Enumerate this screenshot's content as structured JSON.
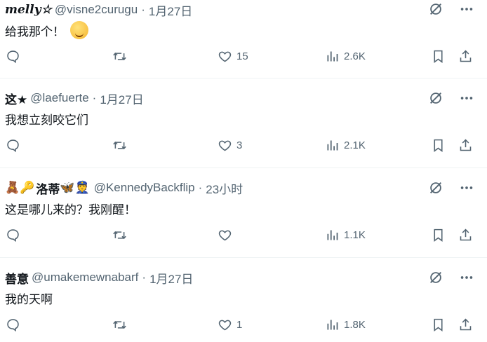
{
  "tweets": [
    {
      "name": "melly☆",
      "name_emoji": "",
      "handle": "@visne2curugu",
      "separator": "·",
      "time": "1月27日",
      "text": "给我那个！",
      "likes": "15",
      "views": "2.6K",
      "has_face_emoji": true
    },
    {
      "name": "这★",
      "name_emoji": "",
      "handle": "@laefuerte",
      "separator": "·",
      "time": "1月27日",
      "text": "我想立刻咬它们",
      "likes": "3",
      "views": "2.1K",
      "has_face_emoji": false
    },
    {
      "name": "洛蒂",
      "name_emoji_before": "🧸🔑",
      "name_emoji_after": "🦋👮",
      "handle": "@KennedyBackflip",
      "separator": "·",
      "time": "23小时",
      "text": "这是哪儿来的？我刚醒！",
      "likes": "",
      "views": "1.1K",
      "has_face_emoji": false
    },
    {
      "name": "善意",
      "name_emoji": "",
      "handle": "@umakemewnabarf",
      "separator": "·",
      "time": "1月27日",
      "text": "我的天啊",
      "likes": "1",
      "views": "1.8K",
      "has_face_emoji": false
    }
  ],
  "icons": {
    "grok": "grok-icon",
    "more": "more-icon",
    "reply": "reply-icon",
    "retweet": "retweet-icon",
    "like": "heart-icon",
    "views": "views-icon",
    "bookmark": "bookmark-icon",
    "share": "share-icon"
  },
  "colors": {
    "text": "#0f1419",
    "muted": "#536471",
    "divider": "#eff3f4"
  }
}
